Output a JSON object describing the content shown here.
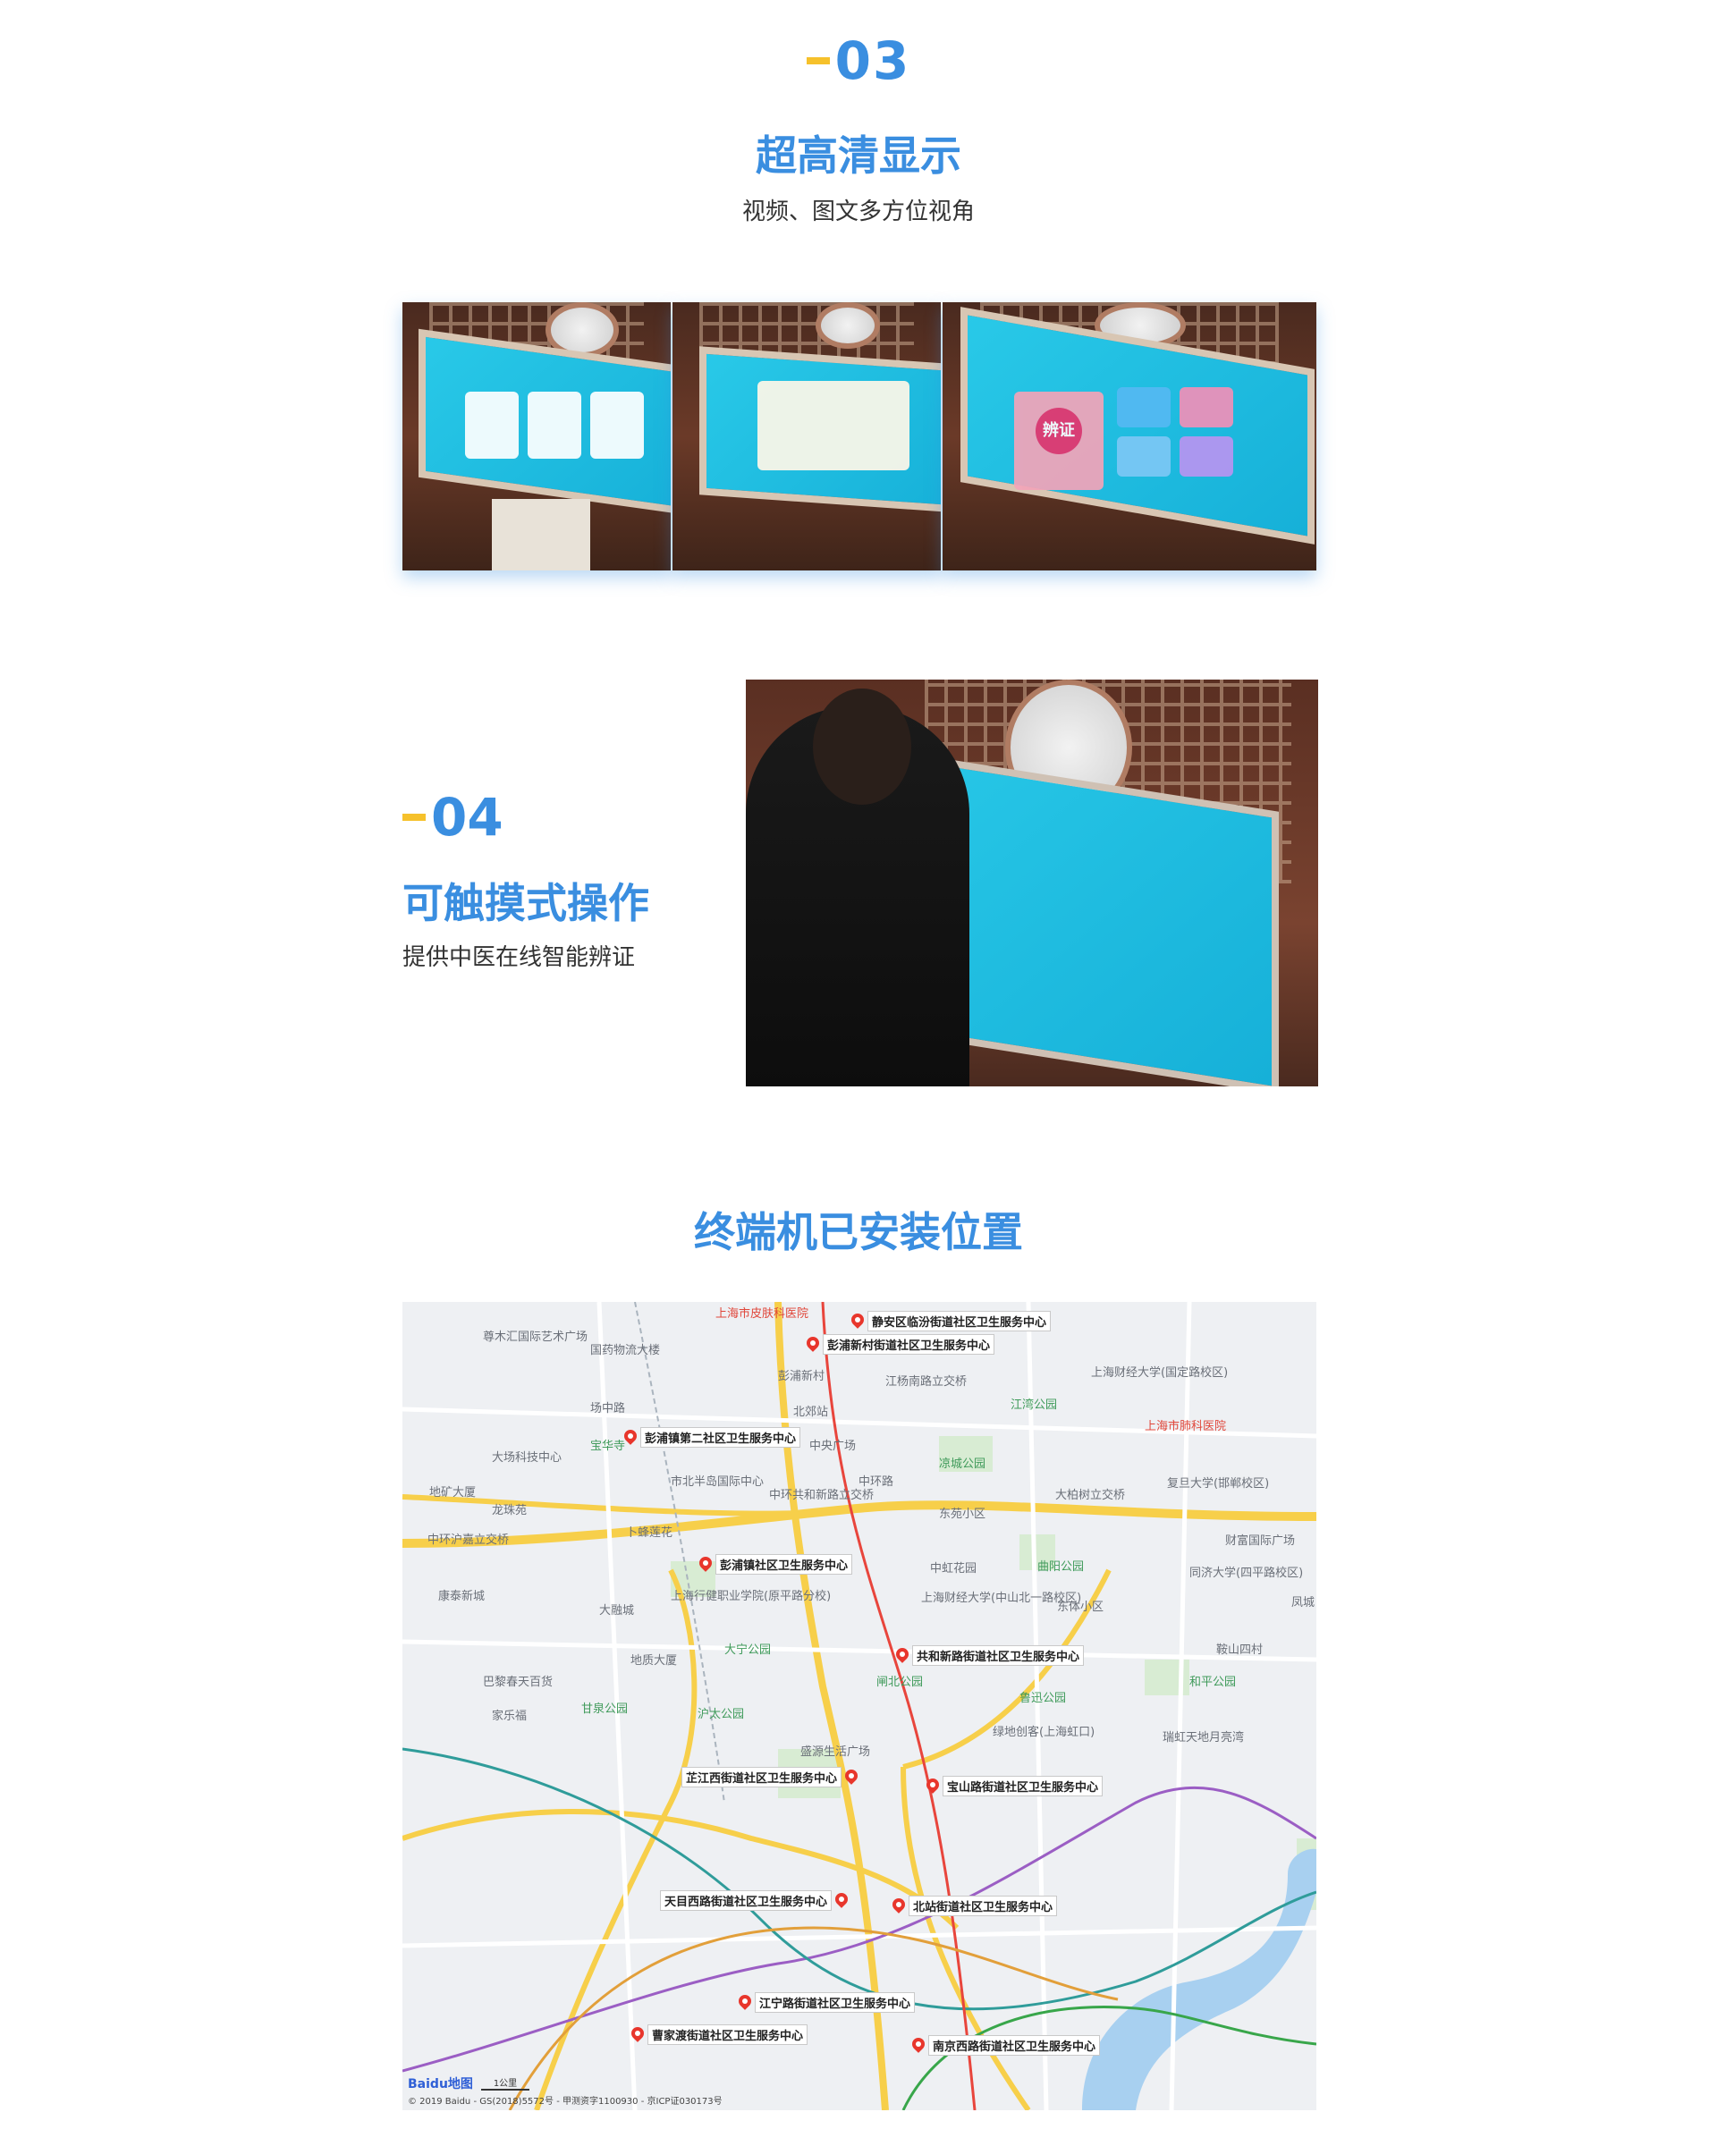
{
  "section03": {
    "number": "03",
    "title": "超高清显示",
    "subtitle": "视频、图文多方位视角",
    "photo3_card_text": "辨证"
  },
  "section04": {
    "number": "04",
    "title": "可触摸式操作",
    "subtitle": "提供中医在线智能辨证"
  },
  "map_section": {
    "title": "终端机已安装位置",
    "markers": [
      "静安区临汾街道社区卫生服务中心",
      "彭浦新村街道社区卫生服务中心",
      "彭浦镇第二社区卫生服务中心",
      "彭浦镇社区卫生服务中心",
      "共和新路街道社区卫生服务中心",
      "芷江西街道社区卫生服务中心",
      "宝山路街道社区卫生服务中心",
      "天目西路街道社区卫生服务中心",
      "北站街道社区卫生服务中心",
      "江宁路街道社区卫生服务中心",
      "曹家渡街道社区卫生服务中心",
      "南京西路街道社区卫生服务中心"
    ],
    "places": [
      "上海市皮肤科医院",
      "尊木汇国际艺术广场",
      "国药物流大楼",
      "彭浦新村",
      "江杨南路立交桥",
      "上海财经大学(国定路校区)",
      "江湾公园",
      "上海市肺科医院",
      "场中路",
      "北郊站",
      "宝华寺",
      "大场科技中心",
      "中央广场",
      "凉城公园",
      "市北半岛国际中心",
      "中环共和新路立交桥",
      "中环路",
      "大柏树立交桥",
      "复旦大学(邯郸校区)",
      "地矿大厦",
      "龙珠苑",
      "东苑小区",
      "中环沪嘉立交桥",
      "卜蜂莲花",
      "中虹花园",
      "曲阳公园",
      "同济大学(四平路校区)",
      "财富国际广场",
      "康泰新城",
      "上海行健职业学院(原平路分校)",
      "上海财经大学(中山北一路校区)",
      "东体小区",
      "凤城",
      "大融城",
      "大宁公园",
      "鞍山四村",
      "地质大厦",
      "巴黎春天百货",
      "闸北公园",
      "和平公园",
      "家乐福",
      "甘泉公园",
      "沪太公园",
      "鲁迅公园",
      "绿地创客(上海虹口)",
      "瑞虹天地月亮湾",
      "盛源生活广场"
    ],
    "copyright": "© 2019 Baidu - GS(2018)5572号 - 甲测资字1100930 - 京ICP证030173号",
    "brand": "Baidu地图",
    "scale_label": "1公里"
  },
  "colors": {
    "accent": "#3a8ee0",
    "dash": "#f6c12b",
    "pin": "#e8362c"
  }
}
